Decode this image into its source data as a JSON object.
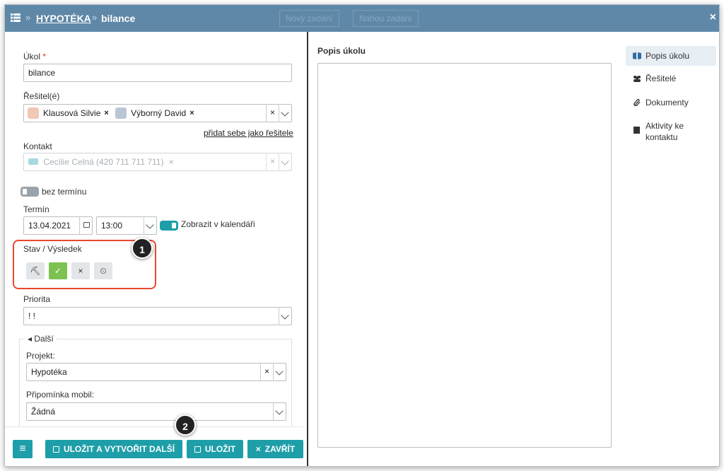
{
  "header": {
    "breadcrumb_sep": "»",
    "project": "HYPOTÉKA",
    "task": "bilance",
    "ghost_buttons": [
      "Nový zadání",
      "Nahou zadání"
    ],
    "close": "×"
  },
  "form": {
    "ukol_label": "Úkol",
    "required_mark": "*",
    "ukol_value": "bilance",
    "resitel_label": "Řešitel(é)",
    "resitele": [
      {
        "name": "Klausová Silvie",
        "remove": "×"
      },
      {
        "name": "Výborný David",
        "remove": "×"
      }
    ],
    "clear": "×",
    "add_self_link": "přidat sebe jako řešitele",
    "kontakt_label": "Kontakt",
    "kontakt_value": "Cecílie Celná (420 711 711 711)",
    "kontakt_remove": "×",
    "bez_terminu_label": "bez termínu",
    "termin_label": "Termín",
    "date_value": "13.04.2021",
    "time_value": "13:00",
    "kalendar_label": "Zobrazit v kalendáři",
    "stav_label": "Stav / Výsledek",
    "stav_buttons": [
      {
        "name": "in-progress",
        "glyph": "⛏"
      },
      {
        "name": "done",
        "glyph": "✓"
      },
      {
        "name": "cancel",
        "glyph": "×"
      },
      {
        "name": "postpone",
        "glyph": "⏲"
      }
    ],
    "priorita_label": "Priorita",
    "priorita_value": "! !",
    "dalsi_label": "Další",
    "projekt_label": "Projekt:",
    "projekt_value": "Hypotéka",
    "pripominka_label": "Připomínka mobil:",
    "pripominka_value": "Žádná"
  },
  "badges": {
    "first": "1",
    "second": "2"
  },
  "toolbar": {
    "menu_glyph": "≡",
    "save_new": "ULOŽIT A VYTVOŘIT DALŠÍ",
    "save": "ULOŽIT",
    "close": "ZAVŘÍT",
    "close_glyph": "×"
  },
  "description": {
    "title": "Popis úkolu",
    "value": ""
  },
  "sidebar": {
    "items": [
      {
        "label": "Popis úkolu",
        "icon": "book-icon",
        "active": true
      },
      {
        "label": "Řešitelé",
        "icon": "users-icon",
        "active": false
      },
      {
        "label": "Dokumenty",
        "icon": "paperclip-icon",
        "active": false
      },
      {
        "label": "Aktivity ke kontaktu",
        "icon": "note-icon",
        "active": false
      }
    ]
  },
  "colors": {
    "header": "#5f88a8",
    "accent": "#1e9ea8",
    "done_green": "#7cc251",
    "highlight_red": "#e8472f"
  }
}
